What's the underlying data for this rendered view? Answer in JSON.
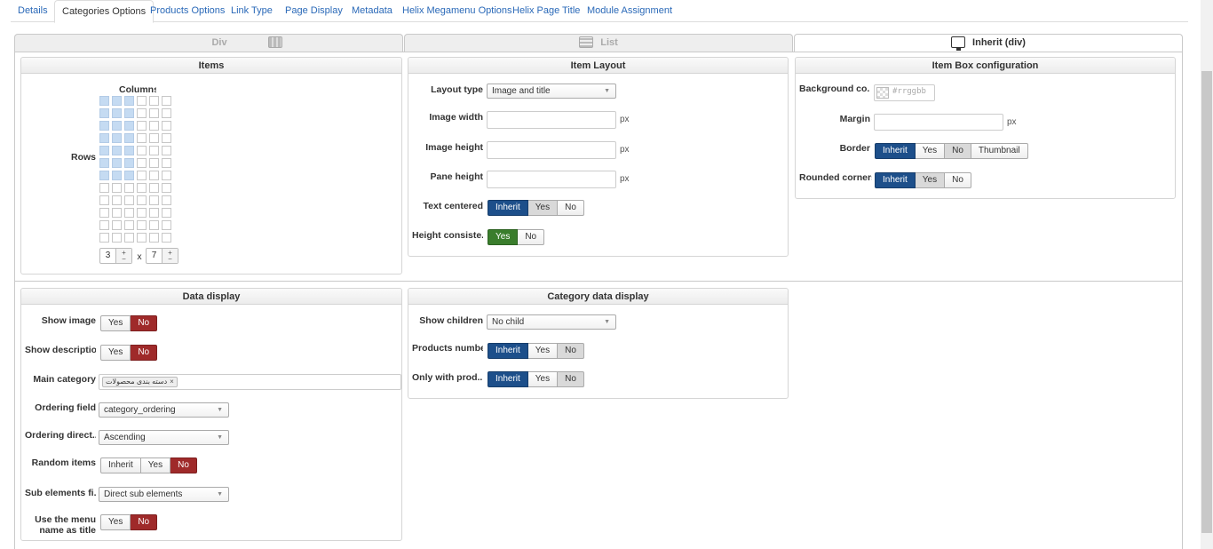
{
  "tabs": [
    "Details",
    "Categories Options",
    "Products Options",
    "Link Type",
    "Page Display",
    "Metadata",
    "Helix Megamenu Options",
    "Helix Page Title",
    "Module Assignment"
  ],
  "layout_tabs": [
    {
      "label": "Div",
      "icon": "grid-icon",
      "active": false
    },
    {
      "label": "List",
      "icon": "list-icon",
      "active": false
    },
    {
      "label": "Inherit (div)",
      "icon": "monitor-icon",
      "active": true
    }
  ],
  "items": {
    "title": "Items",
    "columns_label": "Columns",
    "rows_label": "Rows",
    "grid": {
      "total_columns": 6,
      "total_rows": 12,
      "selected_columns": 3,
      "selected_rows": 7
    },
    "columns_value": "3",
    "times": "x",
    "rows_value": "7",
    "plus": "+",
    "minus": "−"
  },
  "item_layout": {
    "title": "Item Layout",
    "layout_type_label": "Layout type",
    "layout_type_value": "Image and title",
    "image_width_label": "Image width",
    "image_height_label": "Image height",
    "pane_height_label": "Pane height",
    "unit": "px",
    "text_centered_label": "Text centered",
    "text_centered_options": [
      "Inherit",
      "Yes",
      "No"
    ],
    "height_consistency_label": "Height consiste...",
    "height_consistency_options": [
      "Yes",
      "No"
    ]
  },
  "item_box": {
    "title": "Item Box configuration",
    "background_label": "Background co...",
    "background_placeholder": "#rrggbb",
    "margin_label": "Margin",
    "unit": "px",
    "border_label": "Border",
    "border_options": [
      "Inherit",
      "Yes",
      "No",
      "Thumbnail"
    ],
    "rounded_label": "Rounded corners",
    "rounded_options": [
      "Inherit",
      "Yes",
      "No"
    ]
  },
  "data_display": {
    "title": "Data display",
    "show_image_label": "Show image",
    "show_image_options": [
      "Yes",
      "No"
    ],
    "show_description_label": "Show description",
    "show_description_options": [
      "Yes",
      "No"
    ],
    "main_category_label": "Main category",
    "main_category_value": "دسته بندی محصولات",
    "ordering_field_label": "Ordering field",
    "ordering_field_value": "category_ordering",
    "ordering_direction_label": "Ordering direct...",
    "ordering_direction_value": "Ascending",
    "random_items_label": "Random items",
    "random_items_options": [
      "Inherit",
      "Yes",
      "No"
    ],
    "sub_elements_label": "Sub elements fi...",
    "sub_elements_value": "Direct sub elements",
    "menu_name_label_1": "Use the menu",
    "menu_name_label_2": "name as title",
    "menu_name_options": [
      "Yes",
      "No"
    ]
  },
  "category_data": {
    "title": "Category data display",
    "show_children_label": "Show children",
    "show_children_value": "No child",
    "products_number_label": "Products number",
    "products_number_options": [
      "Inherit",
      "Yes",
      "No"
    ],
    "only_with_products_label": "Only with prod...",
    "only_with_products_options": [
      "Inherit",
      "Yes",
      "No"
    ]
  }
}
